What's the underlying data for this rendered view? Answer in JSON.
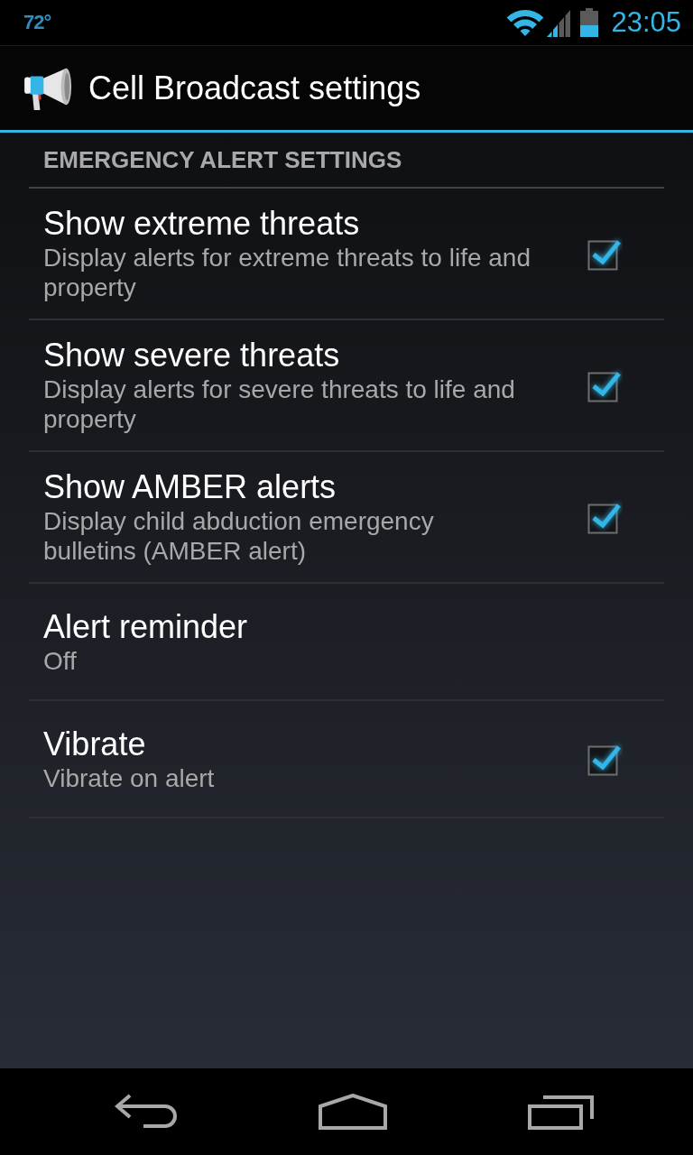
{
  "status_bar": {
    "weather": "72°",
    "time": "23:05"
  },
  "action_bar": {
    "title": "Cell Broadcast settings"
  },
  "category": {
    "title": "EMERGENCY ALERT SETTINGS"
  },
  "preferences": [
    {
      "kind": "checkbox",
      "title": "Show extreme threats",
      "summary": "Display alerts for extreme threats to life and property",
      "checked": true
    },
    {
      "kind": "checkbox",
      "title": "Show severe threats",
      "summary": "Display alerts for severe threats to life and property",
      "checked": true
    },
    {
      "kind": "checkbox",
      "title": "Show AMBER alerts",
      "summary": "Display child abduction emergency bulletins (AMBER alert)",
      "checked": true
    },
    {
      "kind": "list",
      "title": "Alert reminder",
      "summary": "Off"
    },
    {
      "kind": "checkbox",
      "title": "Vibrate",
      "summary": "Vibrate on alert",
      "checked": true
    }
  ]
}
